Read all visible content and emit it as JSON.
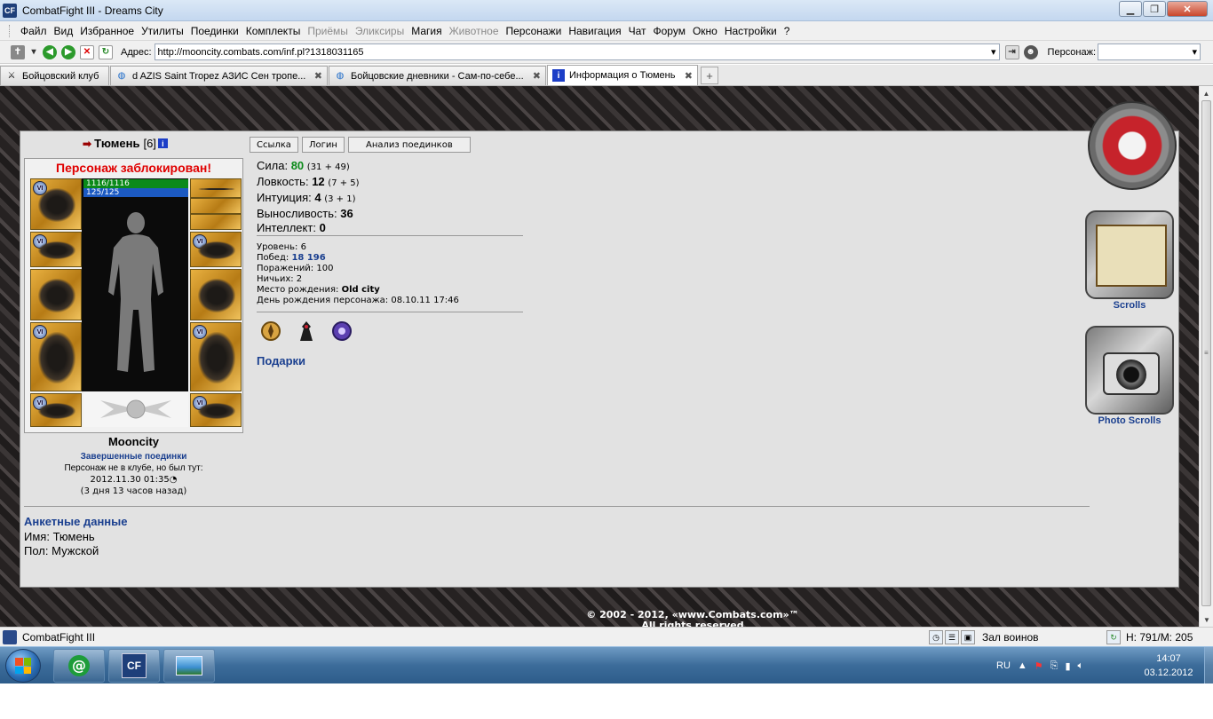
{
  "window": {
    "title": "CombatFight III - Dreams City",
    "app_icon": "CF"
  },
  "menu": [
    "Файл",
    "Вид",
    "Избранное",
    "Утилиты",
    "Поединки",
    "Комплекты",
    "Приёмы",
    "Эликсиры",
    "Магия",
    "Животное",
    "Персонажи",
    "Навигация",
    "Чат",
    "Форум",
    "Окно",
    "Настройки",
    "?"
  ],
  "menu_disabled": [
    "Приёмы",
    "Эликсиры",
    "Животное"
  ],
  "address": {
    "label": "Адрес:",
    "url": "http://mooncity.combats.com/inf.pl?1318031165",
    "persona_label": "Персонаж:"
  },
  "tabs": [
    {
      "label": "Бойцовский клуб",
      "active": false
    },
    {
      "label": "d AZIS Saint Tropez АЗИС Сен тропе...",
      "active": false
    },
    {
      "label": "Бойцовские дневники - Сам-по-себе...",
      "active": false
    },
    {
      "label": "Информация о Тюмень",
      "active": true
    }
  ],
  "character": {
    "name": "Тюмень",
    "level": "[6]",
    "blocked": "Персонаж заблокирован!",
    "hp": "1116/1116",
    "mp": "125/125",
    "city": "Mooncity",
    "fights_link": "Завершенные поединки",
    "not_in_club": "Персонаж не в клубе, но был тут:",
    "last_seen": "2012.11.30 01:35",
    "ago": "(3 дня 13 часов назад)"
  },
  "buttons": {
    "link": "Ссылка",
    "login": "Логин",
    "analysis": "Анализ поединков"
  },
  "stats": [
    {
      "label": "Сила:",
      "value": "80",
      "extra": "(31 + 49)",
      "highlight": true
    },
    {
      "label": "Ловкость:",
      "value": "12",
      "extra": "(7 + 5)",
      "highlight": false
    },
    {
      "label": "Интуиция:",
      "value": "4",
      "extra": "(3 + 1)",
      "highlight": false
    },
    {
      "label": "Выносливость:",
      "value": "36",
      "extra": "",
      "highlight": false
    },
    {
      "label": "Интеллект:",
      "value": "0",
      "extra": "",
      "highlight": false
    }
  ],
  "info": {
    "level_label": "Уровень:",
    "level": "6",
    "wins_label": "Побед:",
    "wins": "18 196",
    "losses_label": "Поражений:",
    "losses": "100",
    "draws_label": "Ничьих:",
    "draws": "2",
    "birthplace_label": "Место рождения:",
    "birthplace": "Old city",
    "birthday_label": "День рождения персонажа:",
    "birthday": "08.10.11 17:46"
  },
  "gifts_link": "Подарки",
  "profile": {
    "title": "Анкетные данные",
    "name_label": "Имя:",
    "name": "Тюмень",
    "sex_label": "Пол:",
    "sex": "Мужской"
  },
  "side": {
    "scrolls": "Scrolls",
    "photo_scrolls": "Photo Scrolls"
  },
  "copyright": "© 2002 - 2012, «www.Combats.com»™",
  "copyright2": "All rights reserved",
  "statusbar": {
    "title": "CombatFight III",
    "hall": "Зал воинов",
    "hp": "H: 791/M: 205"
  },
  "taskbar": {
    "lang": "RU",
    "time": "14:07",
    "date": "03.12.2012"
  },
  "colors": {
    "accent": "#1a3f8f",
    "blocked": "#e00000",
    "hp": "#0b8a19",
    "mp": "#1c5ac2"
  }
}
